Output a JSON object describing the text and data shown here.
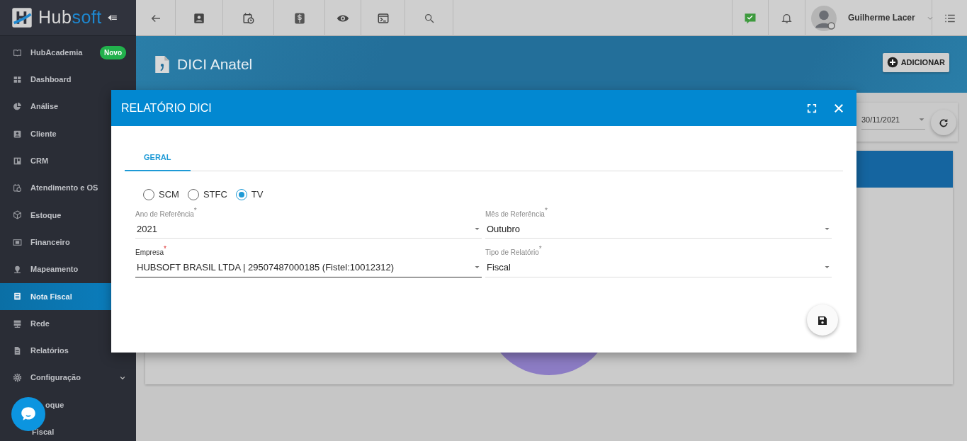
{
  "sidebar": {
    "logo": {
      "main": "Hub",
      "accent": "soft"
    },
    "items": [
      {
        "label": "HubAcademia",
        "badge": "Novo",
        "selected": false
      },
      {
        "label": "Dashboard",
        "selected": false
      },
      {
        "label": "Análise",
        "selected": false
      },
      {
        "label": "Cliente",
        "selected": false
      },
      {
        "label": "CRM",
        "selected": false
      },
      {
        "label": "Atendimento e OS",
        "selected": false
      },
      {
        "label": "Estoque",
        "selected": false
      },
      {
        "label": "Financeiro",
        "selected": false
      },
      {
        "label": "Mapeamento",
        "selected": false
      },
      {
        "label": "Nota Fiscal",
        "selected": true
      },
      {
        "label": "Rede",
        "selected": false
      },
      {
        "label": "Relatórios",
        "selected": false
      },
      {
        "label": "Configuração",
        "selected": false,
        "expanded": true,
        "children": [
          {
            "label": "oque"
          },
          {
            "label": "Fiscal"
          }
        ]
      }
    ]
  },
  "topbar": {
    "user_name": "Guilherme Lacer"
  },
  "page_header": {
    "title": "DICI Anatel",
    "add_button": "ADICIONAR"
  },
  "filter": {
    "date": "30/11/2021"
  },
  "modal": {
    "title": "RELATÓRIO DICI",
    "tabs": [
      {
        "label": "GERAL",
        "selected": true
      }
    ],
    "radios": [
      {
        "label": "SCM",
        "selected": false
      },
      {
        "label": "STFC",
        "selected": false
      },
      {
        "label": "TV",
        "selected": true
      }
    ],
    "fields": [
      {
        "label": "Ano de Referência",
        "required_mark": "*",
        "value": "2021",
        "focused": false
      },
      {
        "label": "Mês de Referência",
        "required_mark": "*",
        "value": "Outubro",
        "focused": false
      },
      {
        "label": "Empresa",
        "required_mark": "*",
        "value": "HUBSOFT BRASIL LTDA | 29507487000185 (Fistel:10012312)",
        "focused": true
      },
      {
        "label": "Tipo de Relatório",
        "required_mark": "*",
        "value": "Fiscal",
        "focused": false
      }
    ]
  }
}
